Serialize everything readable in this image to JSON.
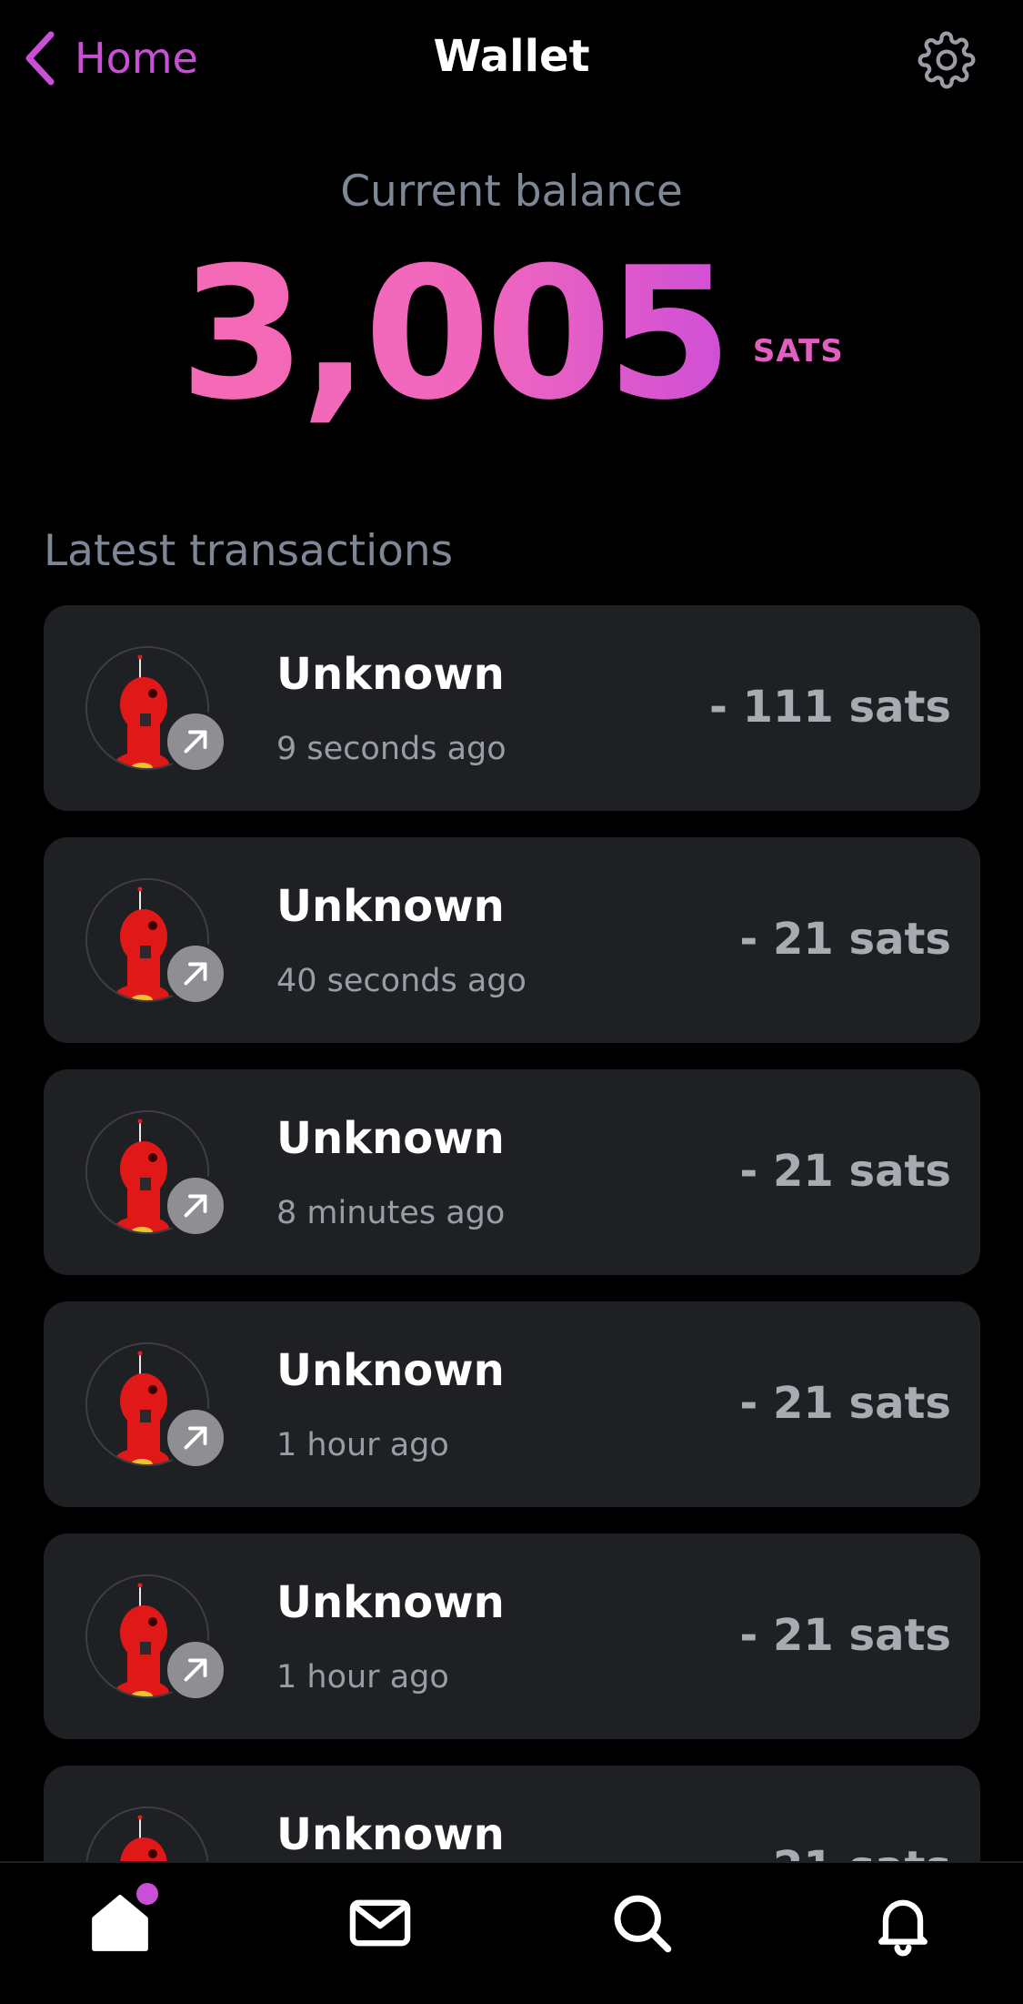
{
  "header": {
    "back_label": "Home",
    "title": "Wallet"
  },
  "balance": {
    "label": "Current balance",
    "amount": "3,005",
    "unit": "SATS"
  },
  "transactions": {
    "label": "Latest transactions",
    "items": [
      {
        "name": "Unknown",
        "time": "9 seconds ago",
        "amount": "- 111 sats"
      },
      {
        "name": "Unknown",
        "time": "40 seconds ago",
        "amount": "- 21 sats"
      },
      {
        "name": "Unknown",
        "time": "8 minutes ago",
        "amount": "- 21 sats"
      },
      {
        "name": "Unknown",
        "time": "1 hour ago",
        "amount": "- 21 sats"
      },
      {
        "name": "Unknown",
        "time": "1 hour ago",
        "amount": "- 21 sats"
      },
      {
        "name": "Unknown",
        "time": "",
        "amount": "- 21 sats"
      }
    ]
  },
  "colors": {
    "accent": "#c94fd6",
    "balance_gradient_start": "#f56bb5",
    "balance_gradient_end": "#cf4fd6",
    "card_bg": "#1f2024",
    "muted_text": "#7e8796"
  },
  "icons": {
    "back": "chevron-left-icon",
    "settings": "gear-icon",
    "tx_direction": "arrow-up-right-icon",
    "tab_home": "home-icon",
    "tab_messages": "mail-icon",
    "tab_search": "search-icon",
    "tab_notifications": "bell-icon"
  }
}
